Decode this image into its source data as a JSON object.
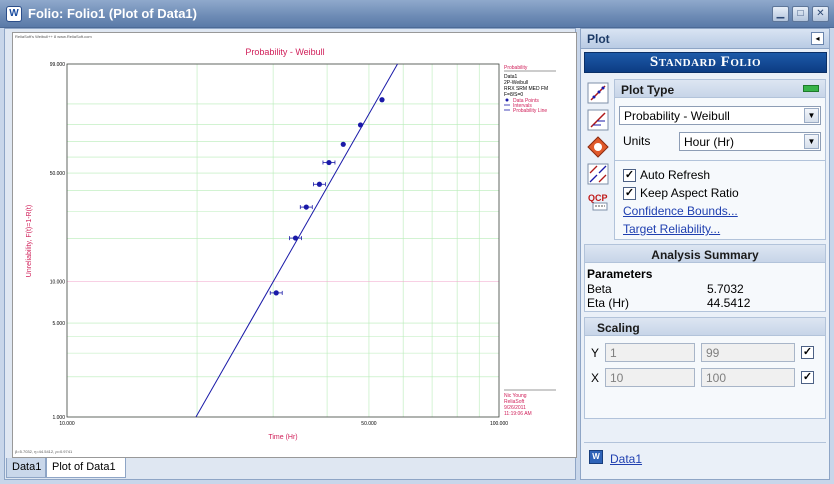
{
  "window": {
    "title": "Folio: Folio1 (Plot of Data1)",
    "min_glyph": "▁",
    "max_glyph": "□",
    "close_glyph": "✕",
    "app_icon_letter": "W"
  },
  "plot": {
    "header_small": "ReliaSoft's Weibull++ 8 www.ReliaSoft.com",
    "title": "Probability - Weibull",
    "ylabel": "Unreliability, F(t)=1-R(t)",
    "xlabel": "Time (Hr)",
    "footer_small": "β=5.7032, η=44.5412, ρ=0.9741",
    "legend": {
      "heading": "Probability",
      "lines": [
        "Data1",
        "2P-Weibull",
        "RRX SRM MED FM",
        "F=8/S=0"
      ],
      "items": [
        "Data Points",
        "Intervals",
        "Probability Line"
      ]
    },
    "info": [
      "Nic Young",
      "ReliaSoft",
      "9/26/2011",
      "11:19:06 AM"
    ],
    "y_ticks": [
      "99.000",
      "50.000",
      "10.000",
      "5.000",
      "1.000"
    ],
    "x_ticks": [
      "10.000",
      "50.000",
      "100.000"
    ],
    "colors": {
      "title": "#d0205a",
      "line": "#1a1aa8",
      "grid": "#b8ecb8",
      "tenline": "#f2a0c8"
    }
  },
  "chart_data": {
    "type": "scatter",
    "title": "Probability - Weibull",
    "xlabel": "Time (Hr)",
    "ylabel": "Unreliability, F(t)=1-R(t)",
    "x_scale": "log",
    "y_scale": "weibull",
    "xlim": [
      10,
      100
    ],
    "ylim": [
      1,
      99
    ],
    "series": [
      {
        "name": "Data Points",
        "x": [
          30.5,
          33.8,
          35.8,
          38.4,
          40.4,
          43.6,
          47.8,
          53.6
        ],
        "y": [
          8.3,
          20.1,
          31.9,
          43.5,
          56.5,
          68.1,
          79.8,
          91.6
        ]
      },
      {
        "name": "Probability Line",
        "beta": 5.7032,
        "eta": 44.5412
      }
    ]
  },
  "tabs": [
    "Data1",
    "Plot of Data1"
  ],
  "side": {
    "title": "Plot",
    "collapse_glyph": "◂",
    "banner": "Standard Folio",
    "plot_type_title": "Plot Type",
    "plot_type_value": "Probability - Weibull",
    "units_label": "Units",
    "units_value": "Hour (Hr)",
    "auto_refresh": "Auto Refresh",
    "keep_aspect": "Keep Aspect Ratio",
    "confidence_link": "Confidence Bounds...",
    "target_link": "Target Reliability...",
    "analysis_title": "Analysis Summary",
    "params_label": "Parameters",
    "params": [
      {
        "name": "Beta",
        "value": "5.7032"
      },
      {
        "name": "Eta (Hr)",
        "value": "44.5412"
      }
    ],
    "scaling_title": "Scaling",
    "y_label": "Y",
    "y_min": "1",
    "y_max": "99",
    "x_label": "X",
    "x_min": "10",
    "x_max": "100",
    "data_link": "Data1",
    "check_glyph": "✓",
    "dropdown_glyph": "▼",
    "qcp_label": "QCP"
  }
}
